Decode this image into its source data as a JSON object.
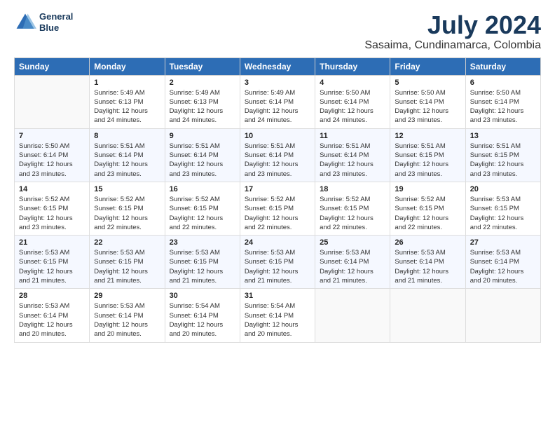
{
  "logo": {
    "line1": "General",
    "line2": "Blue"
  },
  "title": "July 2024",
  "subtitle": "Sasaima, Cundinamarca, Colombia",
  "days_of_week": [
    "Sunday",
    "Monday",
    "Tuesday",
    "Wednesday",
    "Thursday",
    "Friday",
    "Saturday"
  ],
  "weeks": [
    [
      {
        "day": "",
        "sunrise": "",
        "sunset": "",
        "daylight": ""
      },
      {
        "day": "1",
        "sunrise": "Sunrise: 5:49 AM",
        "sunset": "Sunset: 6:13 PM",
        "daylight": "Daylight: 12 hours and 24 minutes."
      },
      {
        "day": "2",
        "sunrise": "Sunrise: 5:49 AM",
        "sunset": "Sunset: 6:13 PM",
        "daylight": "Daylight: 12 hours and 24 minutes."
      },
      {
        "day": "3",
        "sunrise": "Sunrise: 5:49 AM",
        "sunset": "Sunset: 6:14 PM",
        "daylight": "Daylight: 12 hours and 24 minutes."
      },
      {
        "day": "4",
        "sunrise": "Sunrise: 5:50 AM",
        "sunset": "Sunset: 6:14 PM",
        "daylight": "Daylight: 12 hours and 24 minutes."
      },
      {
        "day": "5",
        "sunrise": "Sunrise: 5:50 AM",
        "sunset": "Sunset: 6:14 PM",
        "daylight": "Daylight: 12 hours and 23 minutes."
      },
      {
        "day": "6",
        "sunrise": "Sunrise: 5:50 AM",
        "sunset": "Sunset: 6:14 PM",
        "daylight": "Daylight: 12 hours and 23 minutes."
      }
    ],
    [
      {
        "day": "7",
        "sunrise": "Sunrise: 5:50 AM",
        "sunset": "Sunset: 6:14 PM",
        "daylight": "Daylight: 12 hours and 23 minutes."
      },
      {
        "day": "8",
        "sunrise": "Sunrise: 5:51 AM",
        "sunset": "Sunset: 6:14 PM",
        "daylight": "Daylight: 12 hours and 23 minutes."
      },
      {
        "day": "9",
        "sunrise": "Sunrise: 5:51 AM",
        "sunset": "Sunset: 6:14 PM",
        "daylight": "Daylight: 12 hours and 23 minutes."
      },
      {
        "day": "10",
        "sunrise": "Sunrise: 5:51 AM",
        "sunset": "Sunset: 6:14 PM",
        "daylight": "Daylight: 12 hours and 23 minutes."
      },
      {
        "day": "11",
        "sunrise": "Sunrise: 5:51 AM",
        "sunset": "Sunset: 6:14 PM",
        "daylight": "Daylight: 12 hours and 23 minutes."
      },
      {
        "day": "12",
        "sunrise": "Sunrise: 5:51 AM",
        "sunset": "Sunset: 6:15 PM",
        "daylight": "Daylight: 12 hours and 23 minutes."
      },
      {
        "day": "13",
        "sunrise": "Sunrise: 5:51 AM",
        "sunset": "Sunset: 6:15 PM",
        "daylight": "Daylight: 12 hours and 23 minutes."
      }
    ],
    [
      {
        "day": "14",
        "sunrise": "Sunrise: 5:52 AM",
        "sunset": "Sunset: 6:15 PM",
        "daylight": "Daylight: 12 hours and 23 minutes."
      },
      {
        "day": "15",
        "sunrise": "Sunrise: 5:52 AM",
        "sunset": "Sunset: 6:15 PM",
        "daylight": "Daylight: 12 hours and 22 minutes."
      },
      {
        "day": "16",
        "sunrise": "Sunrise: 5:52 AM",
        "sunset": "Sunset: 6:15 PM",
        "daylight": "Daylight: 12 hours and 22 minutes."
      },
      {
        "day": "17",
        "sunrise": "Sunrise: 5:52 AM",
        "sunset": "Sunset: 6:15 PM",
        "daylight": "Daylight: 12 hours and 22 minutes."
      },
      {
        "day": "18",
        "sunrise": "Sunrise: 5:52 AM",
        "sunset": "Sunset: 6:15 PM",
        "daylight": "Daylight: 12 hours and 22 minutes."
      },
      {
        "day": "19",
        "sunrise": "Sunrise: 5:52 AM",
        "sunset": "Sunset: 6:15 PM",
        "daylight": "Daylight: 12 hours and 22 minutes."
      },
      {
        "day": "20",
        "sunrise": "Sunrise: 5:53 AM",
        "sunset": "Sunset: 6:15 PM",
        "daylight": "Daylight: 12 hours and 22 minutes."
      }
    ],
    [
      {
        "day": "21",
        "sunrise": "Sunrise: 5:53 AM",
        "sunset": "Sunset: 6:15 PM",
        "daylight": "Daylight: 12 hours and 21 minutes."
      },
      {
        "day": "22",
        "sunrise": "Sunrise: 5:53 AM",
        "sunset": "Sunset: 6:15 PM",
        "daylight": "Daylight: 12 hours and 21 minutes."
      },
      {
        "day": "23",
        "sunrise": "Sunrise: 5:53 AM",
        "sunset": "Sunset: 6:15 PM",
        "daylight": "Daylight: 12 hours and 21 minutes."
      },
      {
        "day": "24",
        "sunrise": "Sunrise: 5:53 AM",
        "sunset": "Sunset: 6:15 PM",
        "daylight": "Daylight: 12 hours and 21 minutes."
      },
      {
        "day": "25",
        "sunrise": "Sunrise: 5:53 AM",
        "sunset": "Sunset: 6:14 PM",
        "daylight": "Daylight: 12 hours and 21 minutes."
      },
      {
        "day": "26",
        "sunrise": "Sunrise: 5:53 AM",
        "sunset": "Sunset: 6:14 PM",
        "daylight": "Daylight: 12 hours and 21 minutes."
      },
      {
        "day": "27",
        "sunrise": "Sunrise: 5:53 AM",
        "sunset": "Sunset: 6:14 PM",
        "daylight": "Daylight: 12 hours and 20 minutes."
      }
    ],
    [
      {
        "day": "28",
        "sunrise": "Sunrise: 5:53 AM",
        "sunset": "Sunset: 6:14 PM",
        "daylight": "Daylight: 12 hours and 20 minutes."
      },
      {
        "day": "29",
        "sunrise": "Sunrise: 5:53 AM",
        "sunset": "Sunset: 6:14 PM",
        "daylight": "Daylight: 12 hours and 20 minutes."
      },
      {
        "day": "30",
        "sunrise": "Sunrise: 5:54 AM",
        "sunset": "Sunset: 6:14 PM",
        "daylight": "Daylight: 12 hours and 20 minutes."
      },
      {
        "day": "31",
        "sunrise": "Sunrise: 5:54 AM",
        "sunset": "Sunset: 6:14 PM",
        "daylight": "Daylight: 12 hours and 20 minutes."
      },
      {
        "day": "",
        "sunrise": "",
        "sunset": "",
        "daylight": ""
      },
      {
        "day": "",
        "sunrise": "",
        "sunset": "",
        "daylight": ""
      },
      {
        "day": "",
        "sunrise": "",
        "sunset": "",
        "daylight": ""
      }
    ]
  ]
}
